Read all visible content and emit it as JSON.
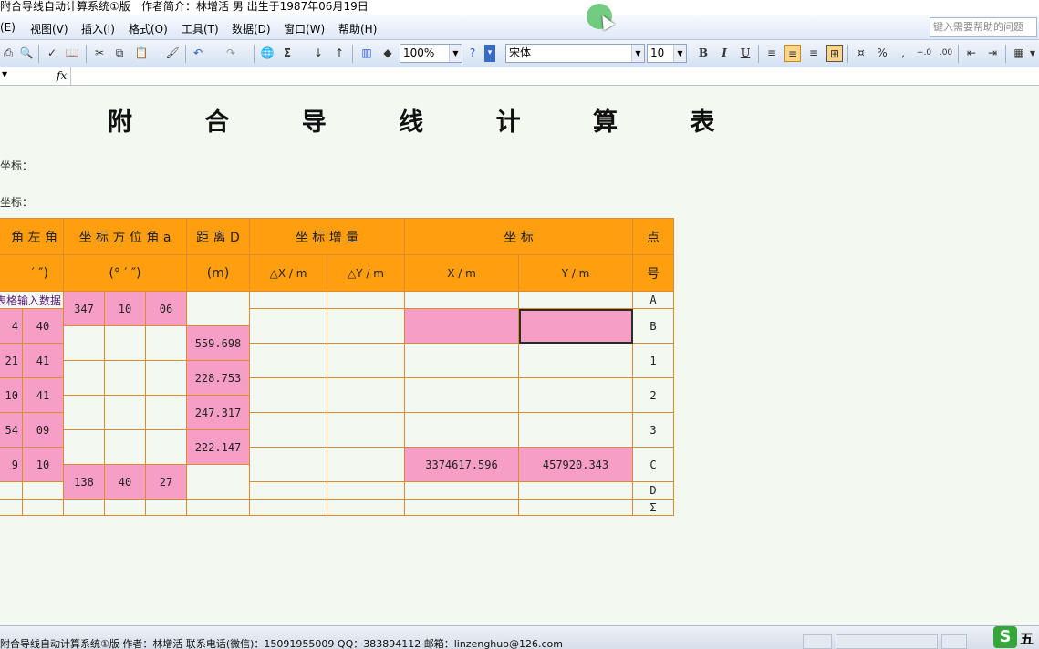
{
  "window": {
    "title": "附合导线自动计算系统①版",
    "author_info": "作者简介：林增活  男  出生于1987年06月19日"
  },
  "menu": {
    "items": [
      "(E)",
      "视图(V)",
      "插入(I)",
      "格式(O)",
      "工具(T)",
      "数据(D)",
      "窗口(W)",
      "帮助(H)"
    ],
    "help_placeholder": "键入需要帮助的问题"
  },
  "toolbar": {
    "zoom": "100%",
    "font_name": "宋体",
    "font_size": "10",
    "bold": "B",
    "italic": "I",
    "underline": "U",
    "percent": "%"
  },
  "formula_bar": {
    "fx": "fx"
  },
  "sheet": {
    "title": "附 合 导 线 计 算 表",
    "label1": "坐标：",
    "label2": "坐标：",
    "headers": {
      "left_angle": "角 左 角",
      "left_angle_unit": "′  ″)",
      "azimuth": "坐 标 方 位 角 a",
      "azimuth_unit": "(°  ′  ″)",
      "distance": "距 离 D",
      "distance_unit": "(m)",
      "increment": "坐  标  增  量",
      "dx": "△X / m",
      "dy": "△Y / m",
      "coord": "坐        标",
      "x": "X / m",
      "y": "Y / m",
      "point_top": "点",
      "point_bottom": "号"
    },
    "input_hint": "表格输入数据",
    "rows": [
      {
        "point": "A",
        "az": [
          "347",
          "10",
          "06"
        ]
      },
      {
        "point": "B",
        "angle": [
          "4",
          "40"
        ]
      },
      {
        "point": "1",
        "angle": [
          "21",
          "41"
        ],
        "dist": "559.698"
      },
      {
        "point": "2",
        "angle": [
          "10",
          "41"
        ],
        "dist": "228.753"
      },
      {
        "point": "3",
        "angle": [
          "54",
          "09"
        ],
        "dist": "247.317"
      },
      {
        "point": "C",
        "angle": [
          "9",
          "10"
        ],
        "dist": "222.147",
        "x": "3374617.596",
        "y": "457920.343"
      },
      {
        "point": "D",
        "az": [
          "138",
          "40",
          "27"
        ]
      },
      {
        "point": "Σ"
      }
    ]
  },
  "status": {
    "text": "附合导线自动计算系统①版   作者：林增活   联系电话(微信)：15091955009   QQ：383894112   邮箱：linzenghuo@126.com",
    "ime_logo": "S",
    "ime_label": "五"
  }
}
